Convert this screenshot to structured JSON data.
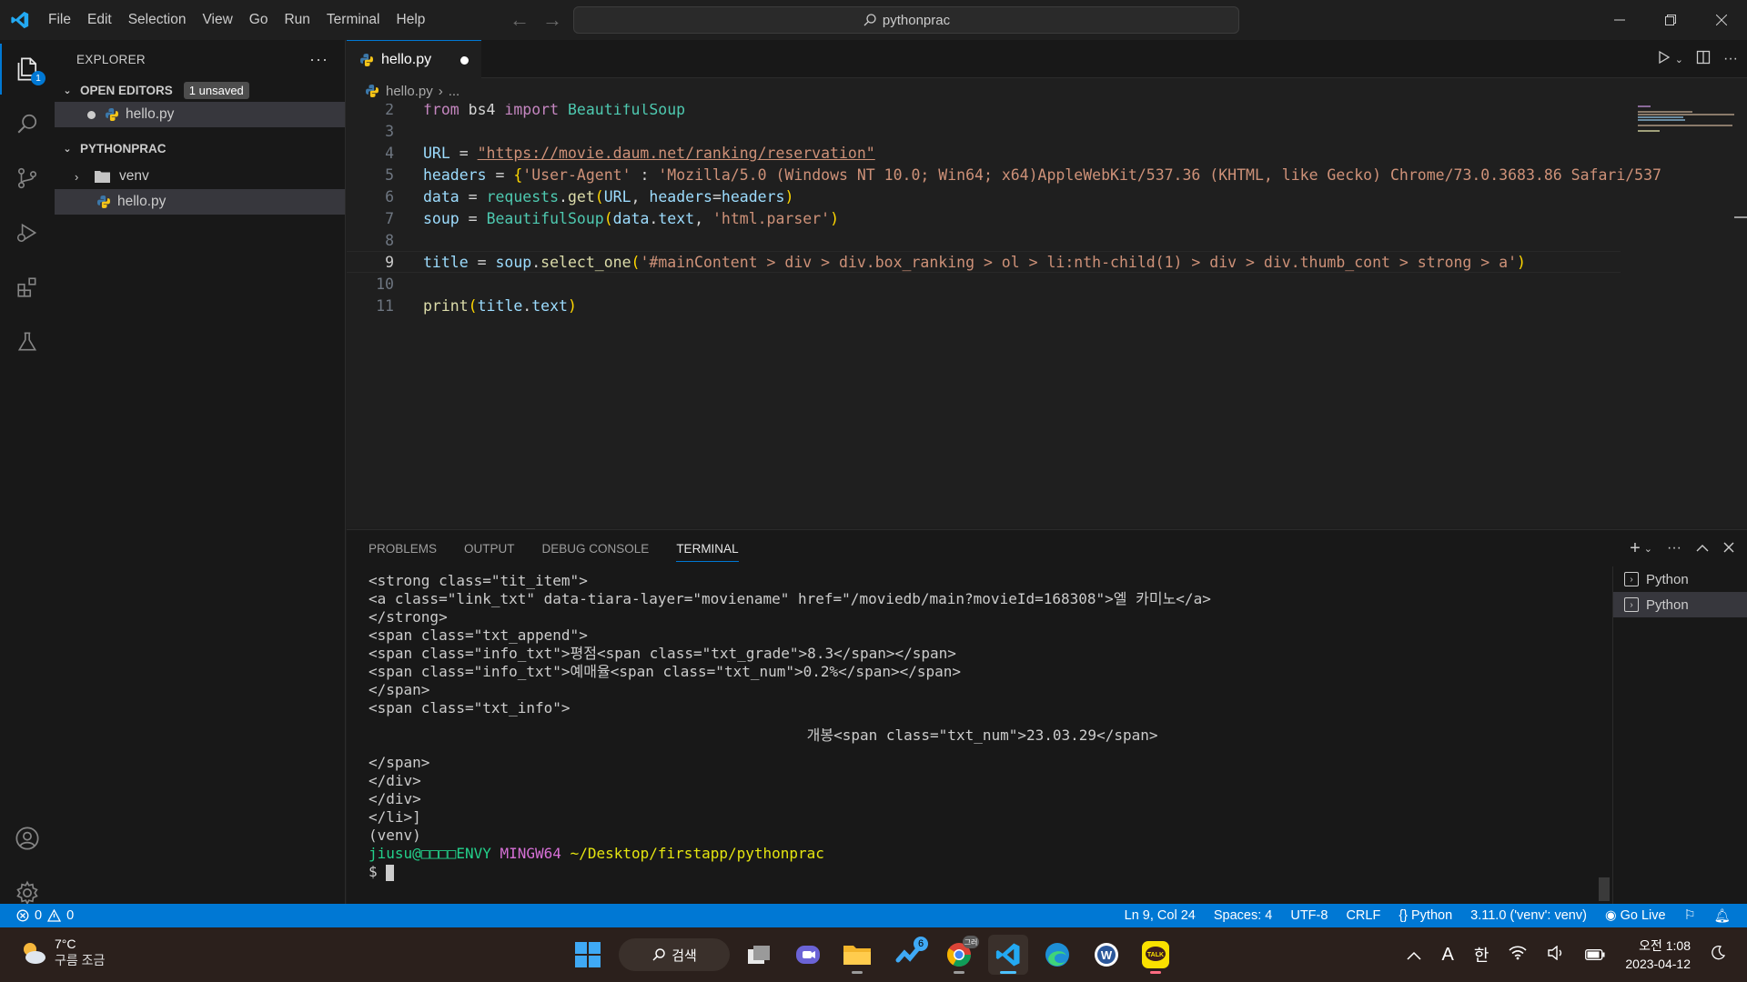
{
  "titlebar": {
    "menu": [
      "File",
      "Edit",
      "Selection",
      "View",
      "Go",
      "Run",
      "Terminal",
      "Help"
    ],
    "command_center": "pythonprac"
  },
  "activitybar": {
    "explorer_badge": "1"
  },
  "sidebar": {
    "header": "EXPLORER",
    "open_editors_label": "OPEN EDITORS",
    "unsaved_badge": "1 unsaved",
    "open_file": "hello.py",
    "workspace_label": "PYTHONPRAC",
    "tree": [
      {
        "name": "venv",
        "type": "folder"
      },
      {
        "name": "hello.py",
        "type": "file"
      }
    ]
  },
  "editor": {
    "tab_label": "hello.py",
    "breadcrumb_file": "hello.py",
    "breadcrumb_rest": "...",
    "line_numbers": [
      "2",
      "3",
      "4",
      "5",
      "6",
      "7",
      "8",
      "9",
      "10",
      "11"
    ],
    "current_line": "9",
    "code": {
      "l2": [
        "from",
        " bs4 ",
        "import",
        " BeautifulSoup"
      ],
      "l4": [
        "URL",
        " = ",
        "\"https://movie.daum.net/ranking/reservation\""
      ],
      "l5": [
        "headers",
        " = ",
        "{",
        "'User-Agent'",
        " : ",
        "'Mozilla/5.0 (Windows NT 10.0; Win64; x64)AppleWebKit/537.36 (KHTML, like Gecko) Chrome/73.0.3683.86 Safari/537"
      ],
      "l6": [
        "data",
        " = ",
        "requests",
        ".",
        "get",
        "(",
        "URL",
        ", ",
        "headers",
        "=",
        "headers",
        ")"
      ],
      "l7": [
        "soup",
        " = ",
        "BeautifulSoup",
        "(",
        "data",
        ".",
        "text",
        ", ",
        "'html.parser'",
        ")"
      ],
      "l9": [
        "title",
        " = ",
        "soup",
        ".",
        "select_one",
        "(",
        "'#mainContent > div > div.box_ranking > ol > li:nth-child(1) > div > div.thumb_cont > strong > a'",
        ")"
      ],
      "l11": [
        "print",
        "(",
        "title",
        ".",
        "text",
        ")"
      ]
    }
  },
  "panel": {
    "tabs": [
      "PROBLEMS",
      "OUTPUT",
      "DEBUG CONSOLE",
      "TERMINAL"
    ],
    "active_tab": "TERMINAL",
    "terminal_lines": [
      "<strong class=\"tit_item\">",
      "<a class=\"link_txt\" data-tiara-layer=\"moviename\" href=\"/moviedb/main?movieId=168308\">엘 카미노</a>",
      "</strong>",
      "<span class=\"txt_append\">",
      "<span class=\"info_txt\">평점<span class=\"txt_grade\">8.3</span></span>",
      "<span class=\"info_txt\">예매율<span class=\"txt_num\">0.2%</span></span>",
      "</span>",
      "<span class=\"txt_info\">",
      "                                                  개봉<span class=\"txt_num\">23.03.29</span>",
      "</span>",
      "</div>",
      "</div>",
      "</li>]",
      "(venv)"
    ],
    "prompt_user": "jiusu@□□□□ENVY",
    "prompt_shell": "MINGW64",
    "prompt_path": "~/Desktop/firstapp/pythonprac",
    "prompt_symbol": "$",
    "terminal_instances": [
      "Python",
      "Python"
    ]
  },
  "statusbar": {
    "errors": "0",
    "warnings": "0",
    "position": "Ln 9, Col 24",
    "spaces": "Spaces: 4",
    "encoding": "UTF-8",
    "eol": "CRLF",
    "language": "Python",
    "interpreter": "3.11.0 ('venv': venv)",
    "golive": "Go Live"
  },
  "taskbar": {
    "temperature": "7°C",
    "weather": "구름 조금",
    "search_label": "검색",
    "steam_badge": "6",
    "chrome_badge": "그러",
    "tray_ime": "A",
    "tray_lang": "한",
    "time": "오전 1:08",
    "date": "2023-04-12"
  },
  "colors": {
    "accent": "#0078d4",
    "statusbar": "#0078d4",
    "editor_bg": "#1f1f1f"
  }
}
